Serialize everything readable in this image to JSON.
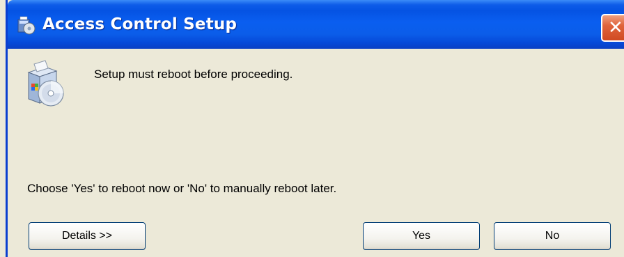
{
  "window": {
    "title": "Access Control Setup",
    "close_glyph": "✕"
  },
  "icons": {
    "title_icon": "setup-icon",
    "app_icon": "install-package-icon",
    "close_icon": "close-icon"
  },
  "dialog": {
    "message": "Setup must reboot before proceeding.",
    "prompt": "Choose 'Yes' to reboot now or 'No' to manually reboot later."
  },
  "buttons": {
    "details": "Details >>",
    "yes": "Yes",
    "no": "No"
  },
  "colors": {
    "titlebar": "#0553e3",
    "close_button": "#e0643c",
    "background": "#ece9d8",
    "button_border": "#003c74"
  }
}
